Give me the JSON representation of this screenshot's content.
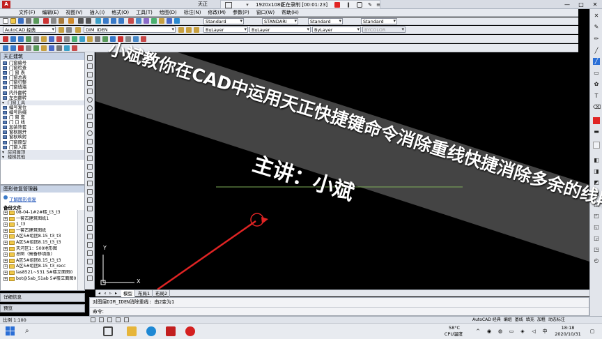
{
  "window": {
    "app_icon_text": "A",
    "title": "天正",
    "buttons": [
      "—",
      "□",
      "✕"
    ]
  },
  "recorder": {
    "resolution": "1920x1080",
    "status": "正在录制 [00:01:23]",
    "icons": [
      "record-stop",
      "pause",
      "camera",
      "pen",
      "menu"
    ]
  },
  "menu": [
    "文件(F)",
    "编辑(E)",
    "视图(V)",
    "插入(I)",
    "格式(O)",
    "工具(T)",
    "绘图(D)",
    "标注(N)",
    "修改(M)",
    "参数(P)",
    "窗口(W)",
    "帮助(H)"
  ],
  "toolbar": {
    "workspace": "AutoCAD 经典",
    "layer": "DIM_IDEN",
    "text_style": "Standard",
    "dim_style": "STANDARI",
    "table_style": "Standard",
    "color": "ByLayer",
    "linetype": "ByLayer",
    "lineweight": "ByLayer",
    "plot_style": "BYCOLOR"
  },
  "tz_panel": {
    "title": "天正建筑",
    "items": [
      {
        "label": "门窗编号",
        "sect": false
      },
      {
        "label": "门窗检查",
        "sect": false
      },
      {
        "label": "门 窗 表",
        "sect": false
      },
      {
        "label": "门窗总表",
        "sect": false
      },
      {
        "label": "门窗归整",
        "sect": false
      },
      {
        "label": "门窗填墙",
        "sect": false
      },
      {
        "label": "内外翻转",
        "sect": false
      },
      {
        "label": "左右翻转",
        "sect": false
      },
      {
        "label": "门窗工具",
        "sect": true
      },
      {
        "label": "编号复位",
        "sect": false
      },
      {
        "label": "编号后缀",
        "sect": false
      },
      {
        "label": "门 窗 套",
        "sect": false
      },
      {
        "label": "门 口 线",
        "sect": false
      },
      {
        "label": "加装饰套",
        "sect": false
      },
      {
        "label": "窗棂展开",
        "sect": false
      },
      {
        "label": "窗棂映射",
        "sect": false
      },
      {
        "label": "门窗原型",
        "sect": false
      },
      {
        "label": "门窗入库",
        "sect": false
      },
      {
        "label": "房间屋顶",
        "sect": true
      },
      {
        "label": "楼梯其他",
        "sect": true
      }
    ]
  },
  "repair_panel": {
    "title": "图形修复管理器",
    "link": "了解图形修复",
    "subtitle": "备份文件",
    "files": [
      "08-04-1#2#楼_t3_t3",
      "一套古建筑图纸1",
      "1_t3",
      "一套古建筑图纸",
      "A区5#组团8.15_t3_t3",
      "A区5#组团8.15_t3_t3",
      "天河区1：500地形图",
      "总图（需备移填版）",
      "A区5#组团8.15_t3_t3",
      "A区5#组团8.15_t3_recc",
      "las8521~531 5#楼立面图0",
      "bot@5ab_51ab 5#楼立面图0"
    ]
  },
  "side_sections": {
    "detail": "详细信息",
    "preview": "预览"
  },
  "canvas": {
    "title": "小斌教你在CAD中运用天正快捷键命令消除重线快捷消除多余的线段",
    "presenter": "主讲：小斌",
    "axis_x": "X",
    "axis_y": "Y"
  },
  "layout_tabs": [
    "模型",
    "布局1",
    "布局2"
  ],
  "command": {
    "history": "对图层DIM_IDEN消除重线: 由2变为1",
    "prompt": "命令:"
  },
  "status": {
    "scale": "比例 1:100",
    "items": [
      "AutoCAD 经典",
      "编组",
      "基线",
      "填充",
      "加粗",
      "动态标注"
    ]
  },
  "taskbar": {
    "weather_temp": "58°C",
    "weather_label": "CPU温度",
    "time": "18:18",
    "date": "2020/10/31"
  },
  "colors": {
    "accent_red": "#e02424",
    "banner": "#4a4a4a"
  }
}
